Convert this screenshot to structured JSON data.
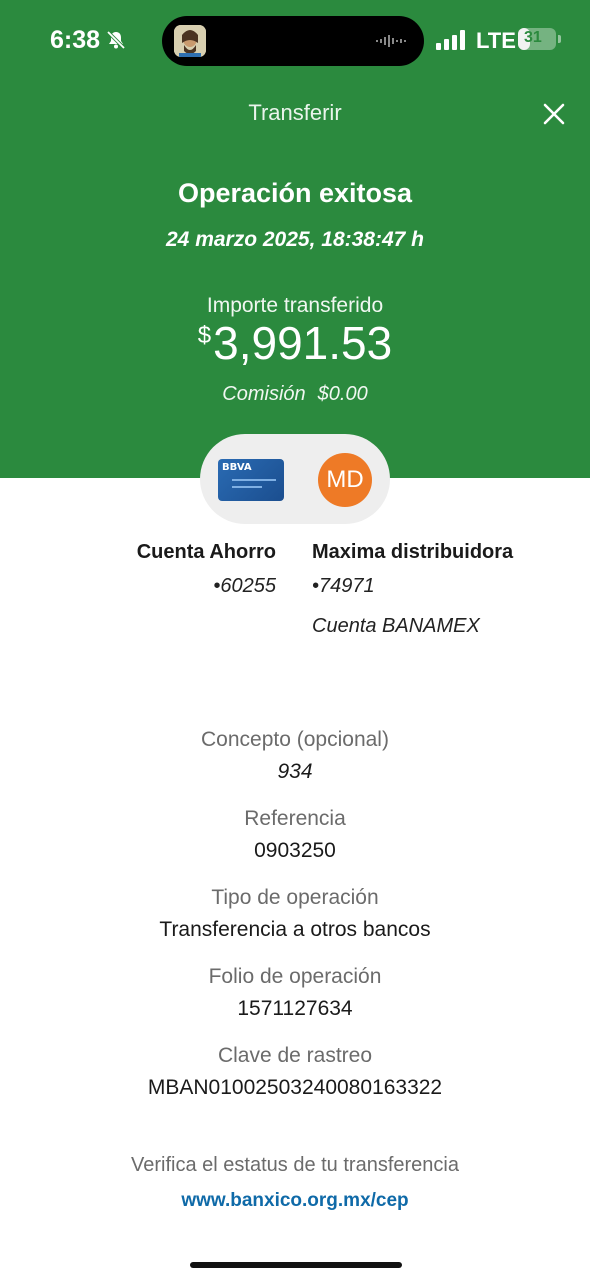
{
  "status_bar": {
    "time": "6:38",
    "network": "LTE",
    "battery_level": "31",
    "battery_fraction": 0.31
  },
  "header": {
    "title": "Transferir",
    "close_icon": "close-icon"
  },
  "result": {
    "title": "Operación exitosa",
    "datetime": "24 marzo 2025, 18:38:47 h",
    "amount_label": "Importe transferido",
    "currency_symbol": "$",
    "amount": "3,991.53",
    "commission_label": "Comisión",
    "commission_value": "$0.00"
  },
  "transfer_pill": {
    "from_card_logo": "BBVA",
    "to_initials": "MD"
  },
  "from_account": {
    "name": "Cuenta Ahorro",
    "number": "•60255"
  },
  "to_account": {
    "name": "Maxima distribuidora",
    "number": "•74971",
    "bank": "Cuenta BANAMEX"
  },
  "details": [
    {
      "label": "Concepto (opcional)",
      "value": "934"
    },
    {
      "label": "Referencia",
      "value": "0903250"
    },
    {
      "label": "Tipo de operación",
      "value": "Transferencia a otros bancos"
    },
    {
      "label": "Folio de operación",
      "value": "1571127634"
    },
    {
      "label": "Clave de rastreo",
      "value": "MBAN01002503240080163322"
    }
  ],
  "footer": {
    "verify_text": "Verifica el estatus de tu transferencia",
    "link_text": "www.banxico.org.mx/cep"
  },
  "colors": {
    "header_green": "#2b8a3e",
    "avatar_orange": "#ee7a26",
    "link_blue": "#0f6aa8"
  }
}
